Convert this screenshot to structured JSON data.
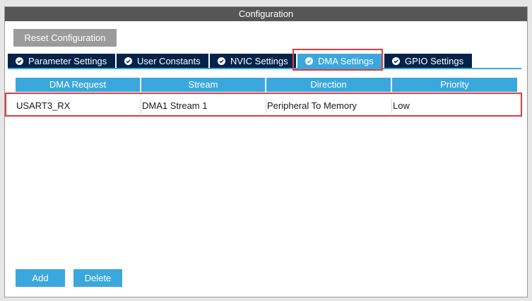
{
  "panel": {
    "title": "Configuration"
  },
  "toolbar": {
    "reset_label": "Reset Configuration"
  },
  "tabs": [
    {
      "label": "Parameter Settings",
      "icon": "check-circle-icon",
      "active": false
    },
    {
      "label": "User Constants",
      "icon": "check-circle-icon",
      "active": false
    },
    {
      "label": "NVIC Settings",
      "icon": "check-circle-icon",
      "active": false
    },
    {
      "label": "DMA Settings",
      "icon": "check-circle-icon",
      "active": true
    },
    {
      "label": "GPIO Settings",
      "icon": "check-circle-icon",
      "active": false
    }
  ],
  "table": {
    "columns": [
      "DMA Request",
      "Stream",
      "Direction",
      "Priority"
    ],
    "rows": [
      [
        "USART3_RX",
        "DMA1 Stream 1",
        "Peripheral To Memory",
        "Low"
      ]
    ]
  },
  "actions": {
    "add_label": "Add",
    "delete_label": "Delete"
  },
  "colors": {
    "accent": "#3aa8dc",
    "tab_bg": "#03234b",
    "title_bg": "#565656",
    "highlight": "#e03b3f",
    "disabled_button": "#9b9b9b"
  }
}
